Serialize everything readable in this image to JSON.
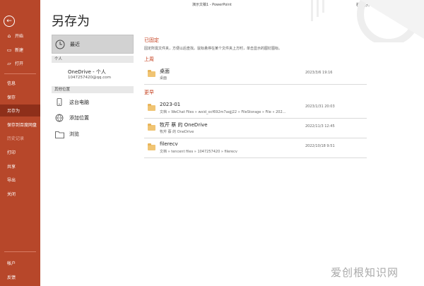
{
  "window": {
    "doc_title": "演示文稿1 - PowerPoint",
    "user_name": "杜 杨开"
  },
  "sidebar": {
    "top_items": [
      {
        "label": "开始",
        "icon": "home-icon"
      },
      {
        "label": "新建",
        "icon": "new-file-icon"
      },
      {
        "label": "打开",
        "icon": "folder-open-icon"
      }
    ],
    "middle_items": [
      {
        "label": "信息"
      },
      {
        "label": "保存"
      },
      {
        "label": "另存为"
      },
      {
        "label": "保存到百度网盘"
      },
      {
        "label": "历史记录"
      },
      {
        "label": "打印"
      },
      {
        "label": "共享"
      },
      {
        "label": "导出"
      },
      {
        "label": "关闭"
      }
    ],
    "bottom_items": [
      {
        "label": "帐户"
      },
      {
        "label": "反馈"
      }
    ]
  },
  "middle": {
    "title": "另存为",
    "recent_label": "最近",
    "personal_header": "个人",
    "onedrive_name": "OneDrive - 个人",
    "onedrive_email": "1047257420@qq.com",
    "other_header": "其他位置",
    "this_pc": "这台电脑",
    "add_location": "添加位置",
    "browse": "浏览"
  },
  "right": {
    "pinned_title": "已固定",
    "pinned_desc": "固定所需文件夹，方便以后查找。鼠标悬停在某个文件夹上方时，单击显示的图钉图标。",
    "group_lastweek": "上周",
    "group_older": "更早",
    "files": [
      {
        "name": "桌面",
        "path": "桌面",
        "date": "2023/3/6 19:16"
      },
      {
        "name": "2023-01",
        "path": "文档 » WeChat Files » wxid_ocf692m7aqjj22 » FileStorage » File » 202...",
        "date": "2023/1/31 20:03"
      },
      {
        "name": "牧芹 蔡 的 OneDrive",
        "path": "牧芹 蔡 的 OneDrive",
        "date": "2022/11/3 12:45"
      },
      {
        "name": "filerecv",
        "path": "文档 » tencent files » 1047257420 » filerecv",
        "date": "2022/10/18 9:51"
      }
    ]
  },
  "watermark": "爱创根知识网",
  "colors": {
    "accent": "#b7472a",
    "active": "#8e2f1a",
    "group_heading": "#c43e1c"
  }
}
